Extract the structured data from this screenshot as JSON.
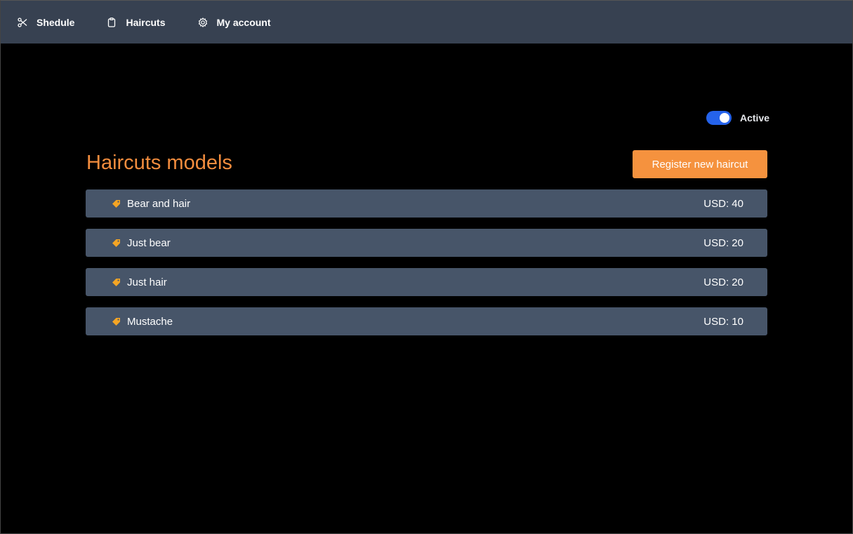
{
  "nav": {
    "items": [
      {
        "label": "Shedule",
        "icon": "scissors-icon"
      },
      {
        "label": "Haircuts",
        "icon": "clipboard-icon"
      },
      {
        "label": "My account",
        "icon": "gear-icon"
      }
    ]
  },
  "status": {
    "label": "Active",
    "enabled": true
  },
  "page": {
    "title": "Haircuts models",
    "register_label": "Register new haircut"
  },
  "haircuts": [
    {
      "name": "Bear and hair",
      "price": "USD: 40"
    },
    {
      "name": "Just bear",
      "price": "USD: 20"
    },
    {
      "name": "Just hair",
      "price": "USD: 20"
    },
    {
      "name": "Mustache",
      "price": "USD: 10"
    }
  ],
  "colors": {
    "navbar": "#374151",
    "accent": "#f5923e",
    "title": "#f38d3e",
    "row": "#475569",
    "toggle": "#2563eb",
    "tag_icon": "#f5a524"
  }
}
